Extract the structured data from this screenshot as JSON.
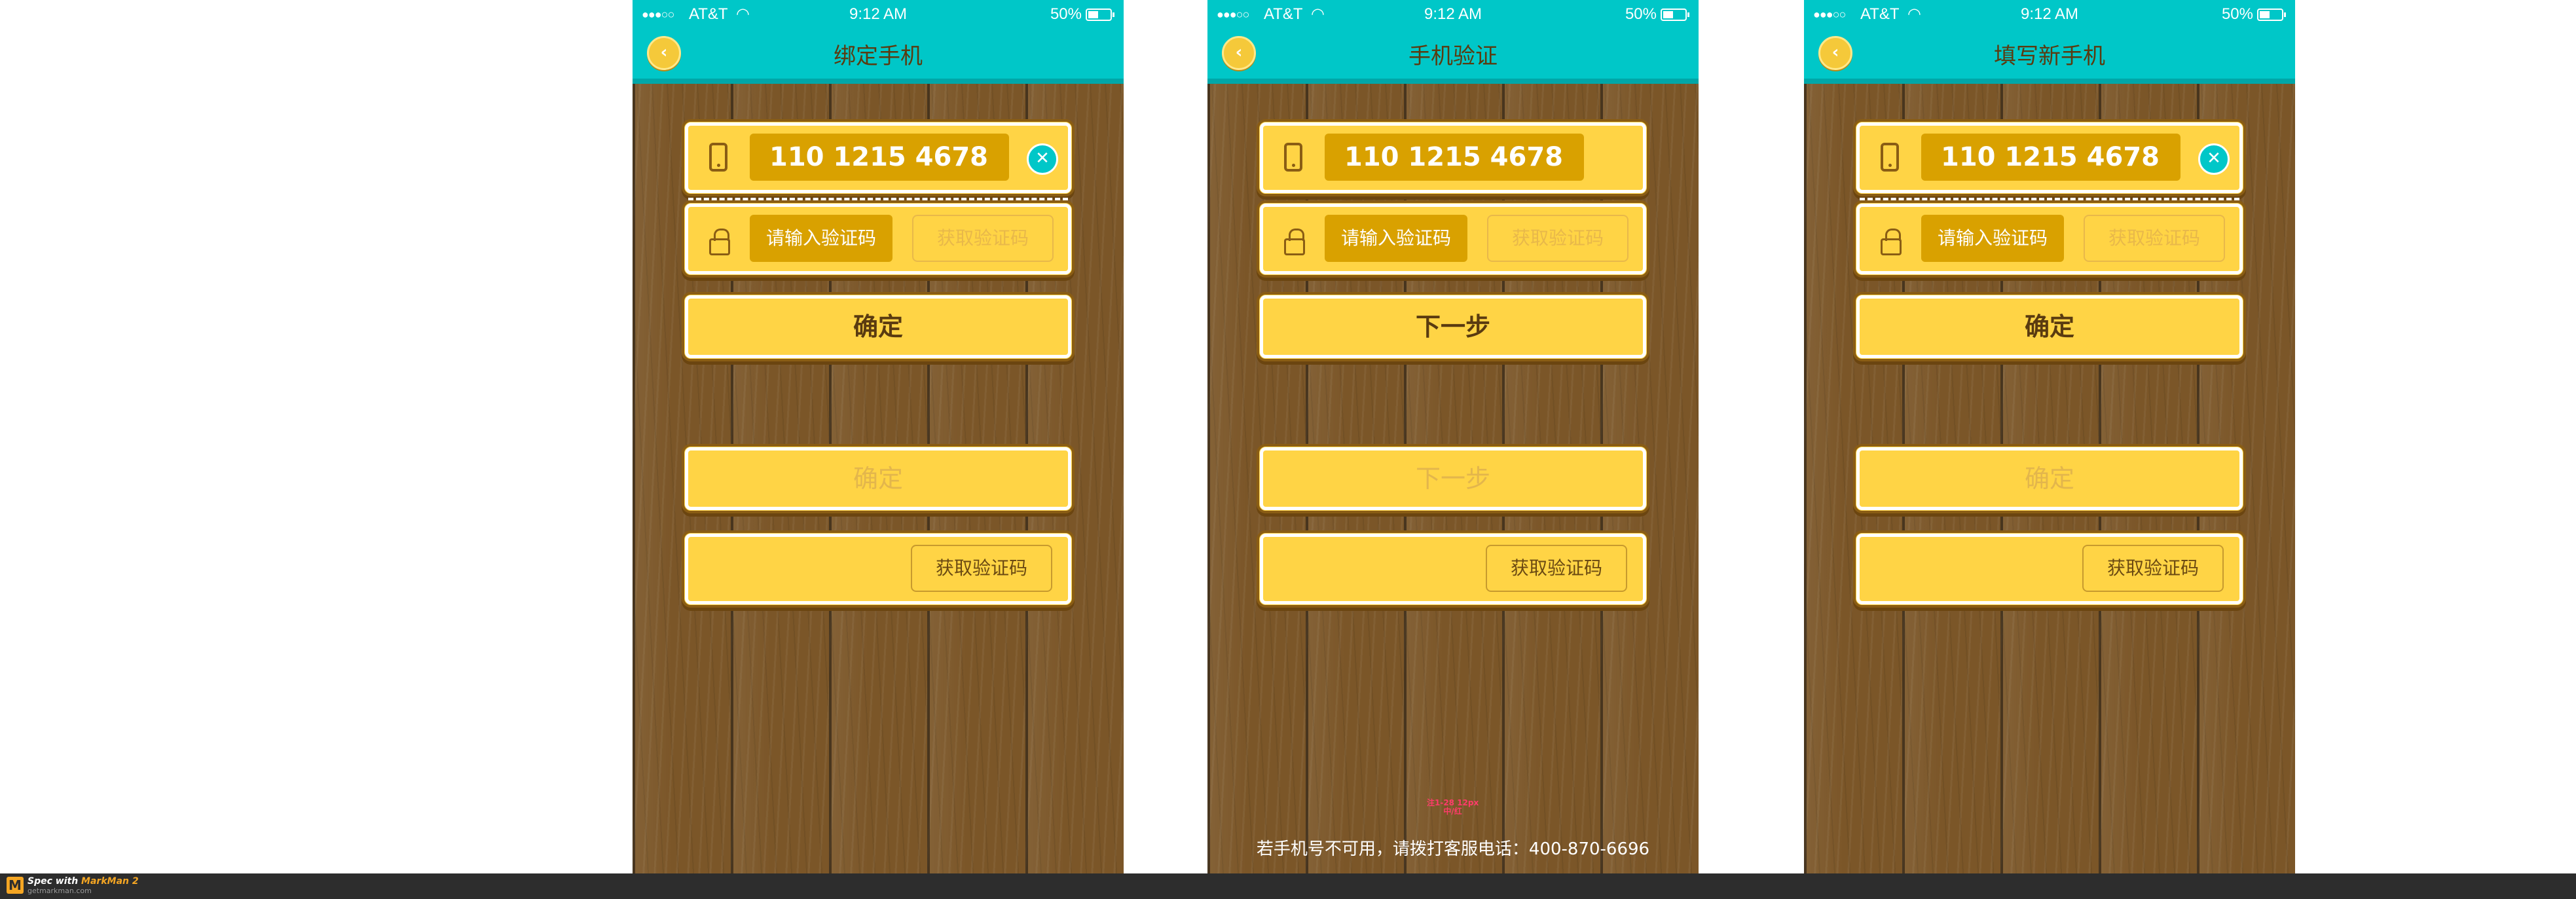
{
  "status_bar": {
    "signal": "●●●○○",
    "carrier": "AT&T",
    "time": "9:12 AM",
    "battery": "50%"
  },
  "screens": [
    {
      "title": "绑定手机",
      "phone": "110 1215 4678",
      "code_placeholder": "请输入验证码",
      "get_code": "获取验证码",
      "primary_button": "确定",
      "disabled_button": "确定",
      "sample_get_code": "获取验证码"
    },
    {
      "title": "手机验证",
      "phone": "110 1215 4678",
      "code_placeholder": "请输入验证码",
      "get_code": "获取验证码",
      "primary_button": "下一步",
      "disabled_button": "下一步",
      "sample_get_code": "获取验证码",
      "hint": "若手机号不可用，请拨打客服电话：400-870-6696",
      "marker": "注1-28 12px\n中/红"
    },
    {
      "title": "填写新手机",
      "phone": "110 1215 4678",
      "code_placeholder": "请输入验证码",
      "get_code": "获取验证码",
      "primary_button": "确定",
      "disabled_button": "确定",
      "sample_get_code": "获取验证码"
    }
  ],
  "footer": {
    "logo": "M",
    "spec_with": "Spec with",
    "brand": "MarkMan 2",
    "url": "getmarkman.com"
  },
  "icons": {
    "back": "chevron-left-icon",
    "phone": "phone-icon",
    "clear": "close-icon",
    "lock": "lock-icon",
    "wifi": "wifi-icon",
    "battery": "battery-icon"
  },
  "colors": {
    "header": "#00c7c8",
    "button": "#ffd445",
    "field": "#d9a100",
    "wood": "#7b5628"
  }
}
